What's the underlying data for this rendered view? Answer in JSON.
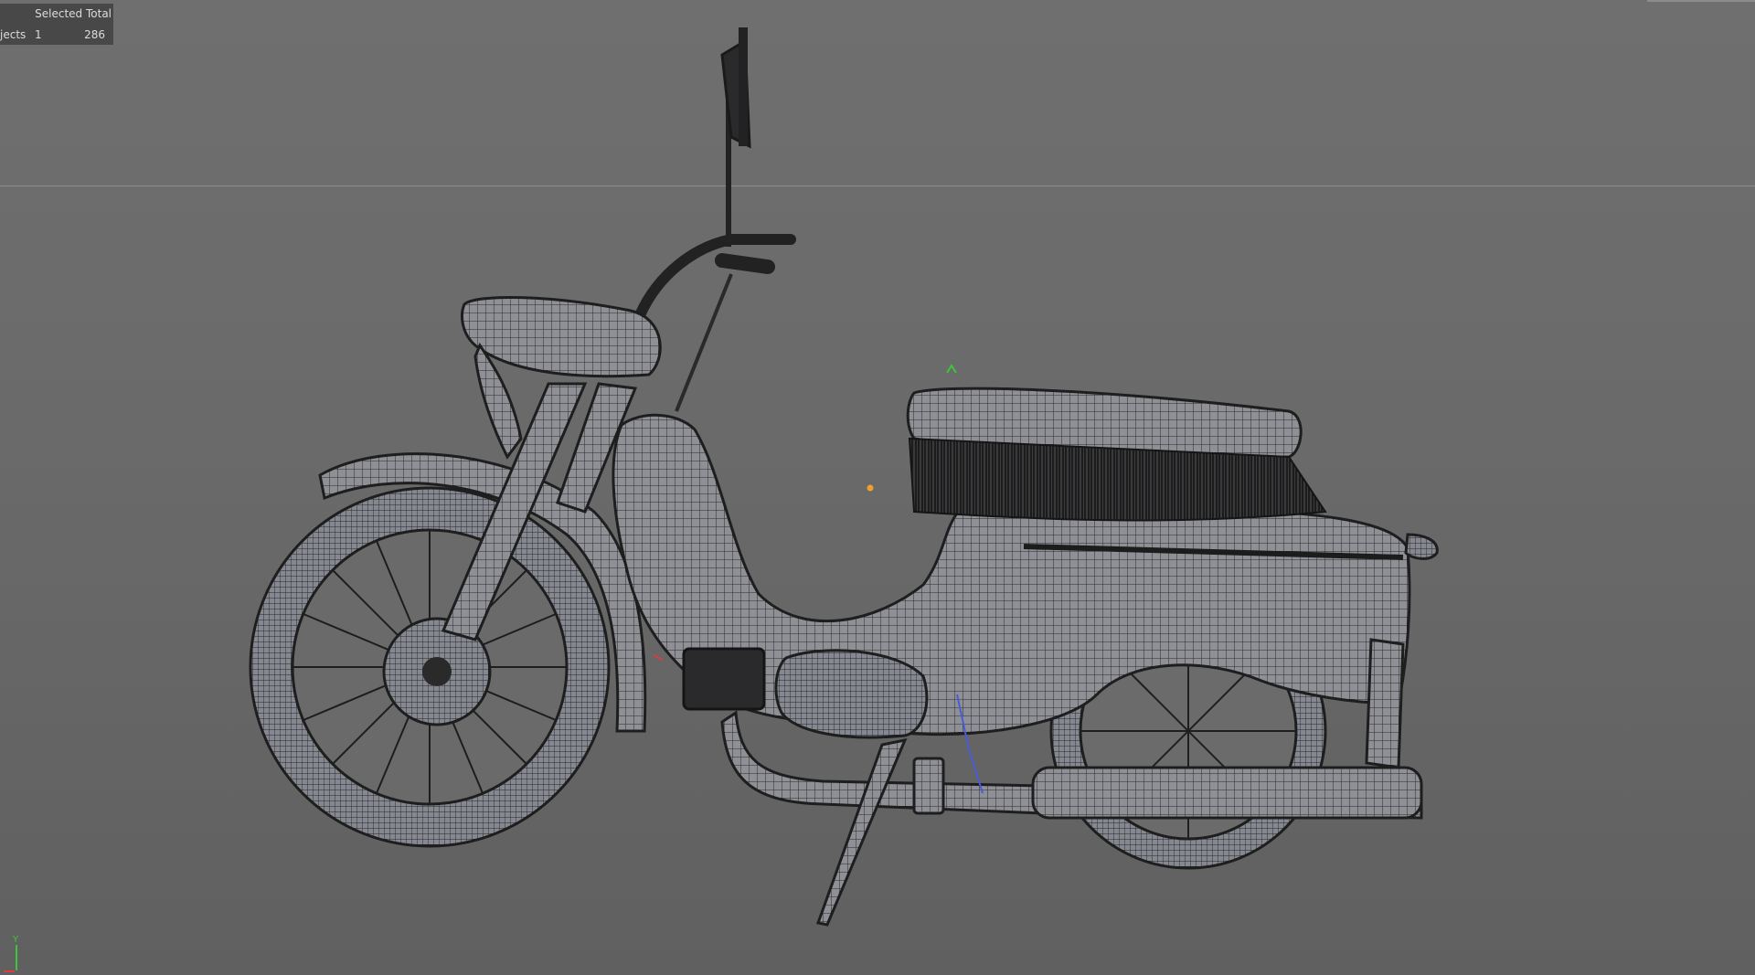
{
  "stats_panel": {
    "header": "Selected Total",
    "row_label": "jects",
    "selected": "1",
    "total": "286"
  },
  "axis_gizmo": {
    "y_label": "Y"
  },
  "colors": {
    "background": "#6a6a6a",
    "wireframe": "#1e1e1e",
    "mesh_fill": "#8e9096",
    "pivot_marker": "#f0a030",
    "y_axis": "#3cc63c",
    "x_axis": "#e03a3a",
    "z_axis": "#4a5bd8"
  }
}
